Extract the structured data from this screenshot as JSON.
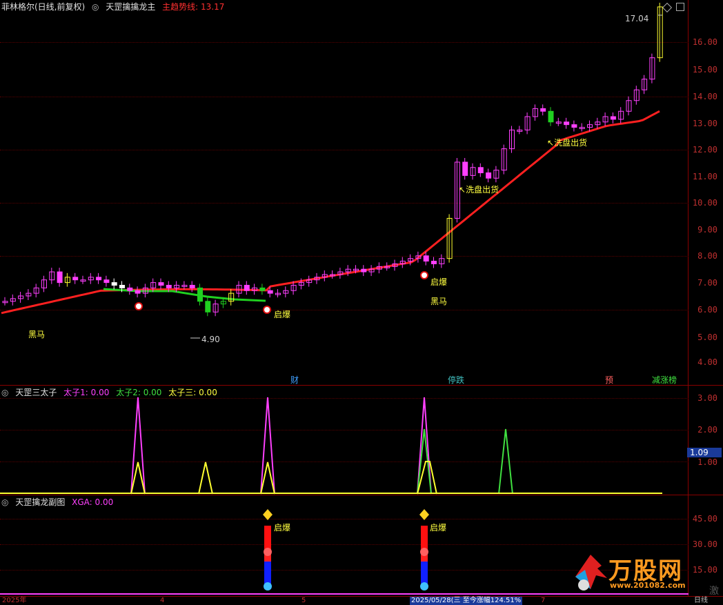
{
  "main": {
    "stock": "菲林格尔(日线,前复权)",
    "indicator": "天罡擒擒龙主",
    "trend_label": "主趋势线:",
    "trend_value": "13.17",
    "high_label": "17.04",
    "low_label": "4.90",
    "heima": "黑马",
    "qibao": "启爆",
    "xipan": "洗盘出货",
    "events": [
      "财",
      "停跌",
      "预",
      "减涨榜"
    ],
    "ticks": [
      "16.00",
      "15.00",
      "14.00",
      "13.00",
      "12.00",
      "11.00",
      "10.00",
      "9.00",
      "8.00",
      "7.00",
      "6.00",
      "5.00",
      "4.00"
    ]
  },
  "sub1": {
    "title": "天罡三太子",
    "t1": "太子1: 0.00",
    "t2": "太子2: 0.00",
    "t3": "太子三: 0.00",
    "ticks": [
      "3.00",
      "2.00",
      "1.00"
    ],
    "cursor_value": "1.09"
  },
  "sub2": {
    "title": "天罡擒龙副图",
    "xga": "XGA: 0.00",
    "qibao": "启爆",
    "ticks": [
      "45.00",
      "30.00",
      "15.00"
    ]
  },
  "footer": {
    "year": "2025年",
    "m4": "4",
    "m5": "5",
    "date_info": "2025/05/28(三 至今涨幅124.51%",
    "m7": "7",
    "period": "日线"
  },
  "watermark": {
    "brand": "万股网",
    "url": "www.201082.com",
    "cn": "激"
  },
  "colors": {
    "up": "#ff40ff",
    "down": "#20d020",
    "trend": "#ff2020",
    "bg": "#000000"
  }
}
